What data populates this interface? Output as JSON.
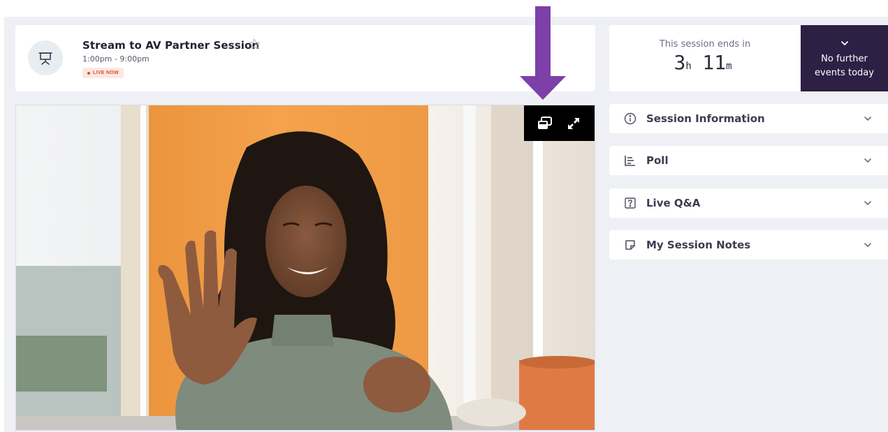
{
  "session": {
    "title": "Stream to AV Partner Session",
    "time": "1:00pm - 9:00pm",
    "live_badge": "LIVE NOW"
  },
  "countdown": {
    "label": "This session ends in",
    "hours": "3",
    "hours_unit": "h",
    "minutes": "11",
    "minutes_unit": "m",
    "further_line1": "No further",
    "further_line2": "events today"
  },
  "panels": [
    {
      "label": "Session Information",
      "icon": "info-icon"
    },
    {
      "label": "Poll",
      "icon": "poll-icon"
    },
    {
      "label": "Live Q&A",
      "icon": "question-icon"
    },
    {
      "label": "My Session Notes",
      "icon": "notes-icon"
    }
  ],
  "video_controls": {
    "picture_in_picture": "picture-in-picture-icon",
    "fullscreen": "expand-icon"
  },
  "colors": {
    "accent_dark": "#2e1f44",
    "annotation_arrow": "#7d3fa8",
    "live_red": "#e0463a",
    "page_bg": "#eef0f5"
  }
}
